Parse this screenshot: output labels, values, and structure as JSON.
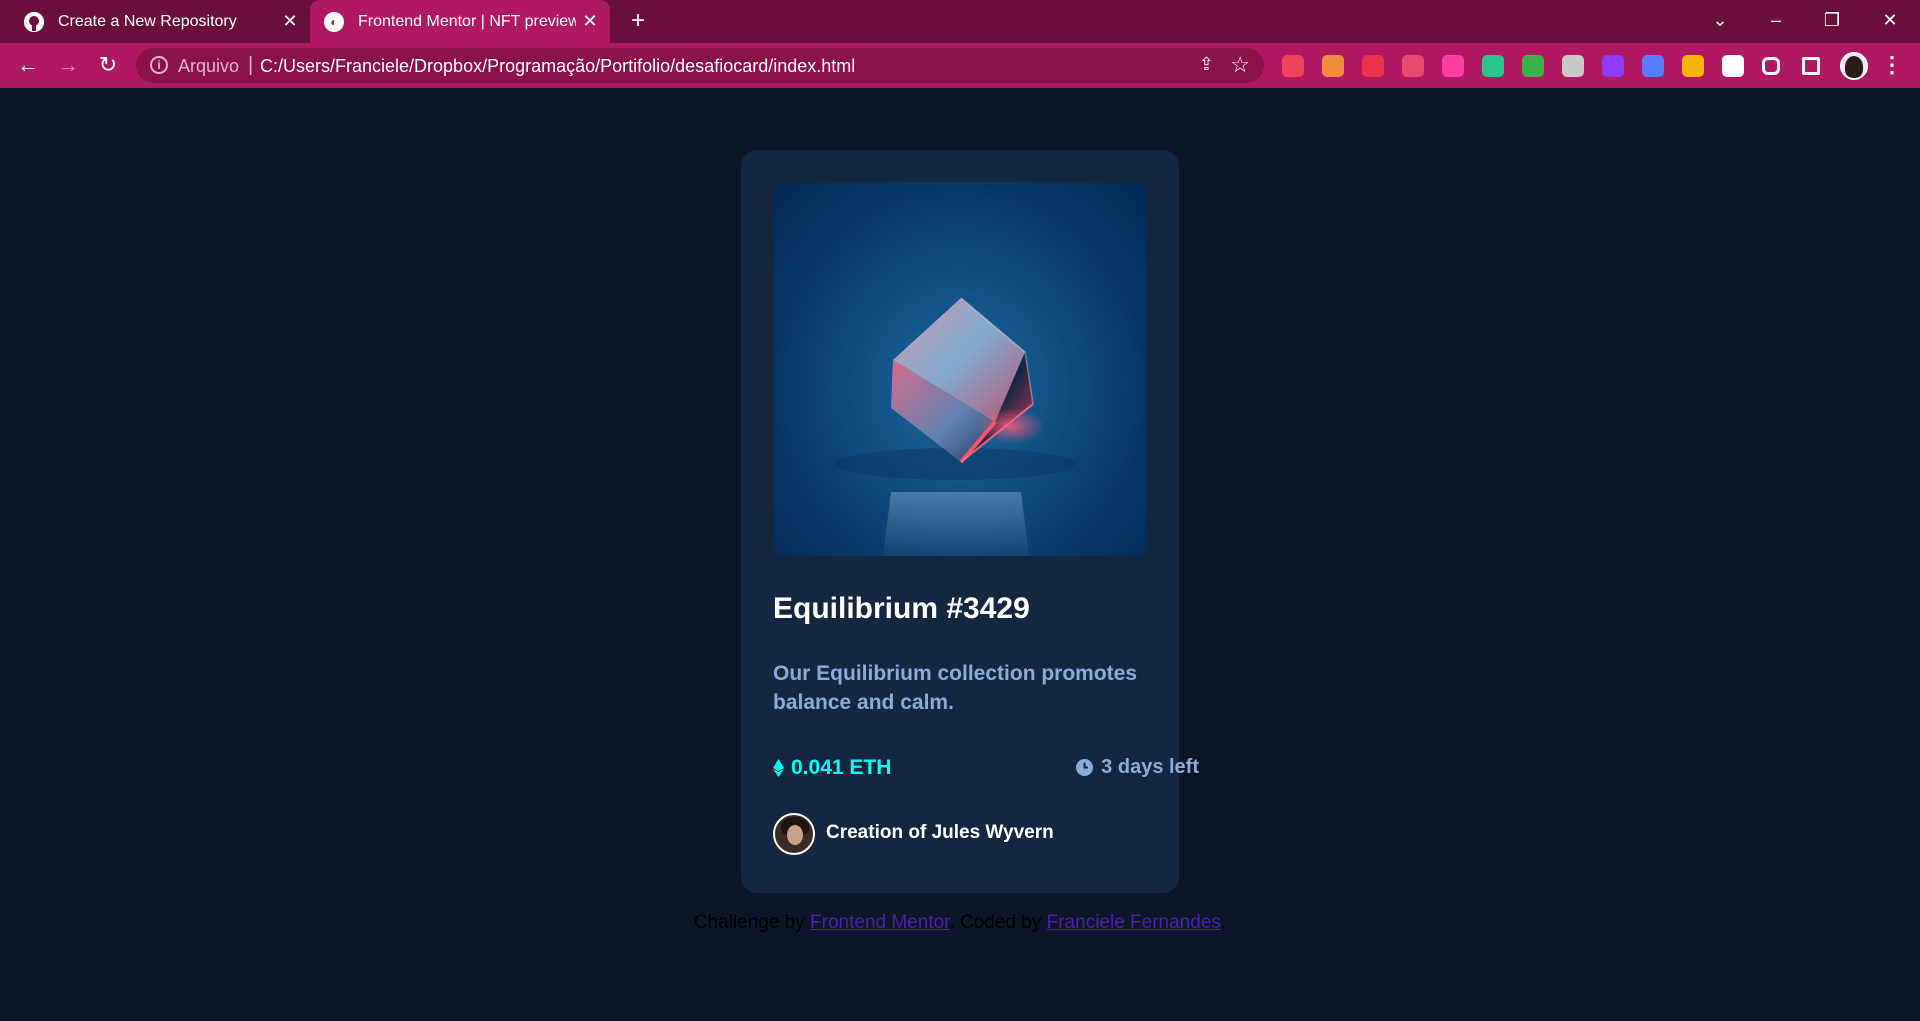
{
  "browser": {
    "tabs": [
      {
        "title": "Create a New Repository",
        "icon": "github-icon",
        "active": false
      },
      {
        "title": "Frontend Mentor | NFT preview c",
        "icon": "frontend-mentor-icon",
        "active": true
      }
    ],
    "address_bar": {
      "scheme_label": "Arquivo",
      "separator": "|",
      "url": "C:/Users/Franciele/Dropbox/Programação/Portifolio/desafiocard/index.html"
    },
    "extensions": [
      {
        "icon": "extension-gift-icon",
        "color": "#f0445a"
      },
      {
        "icon": "extension-fox-icon",
        "color": "#f08a3c"
      },
      {
        "icon": "extension-m-icon",
        "color": "#e8334a"
      },
      {
        "icon": "extension-chat-icon",
        "color": "#e84a6e"
      },
      {
        "icon": "extension-eyedropper-icon",
        "color": "#ff3fa0"
      },
      {
        "icon": "extension-bird-icon",
        "color": "#2bc48a"
      },
      {
        "icon": "extension-stack-icon",
        "color": "#3bb24a"
      },
      {
        "icon": "extension-gear-icon",
        "color": "#c9c9c9"
      },
      {
        "icon": "extension-video-icon",
        "color": "#8a3dff"
      },
      {
        "icon": "extension-flower-icon",
        "color": "#5a7cff"
      },
      {
        "icon": "extension-w-icon",
        "color": "#f4b400"
      },
      {
        "icon": "extension-table-icon",
        "color": "#ffffff"
      },
      {
        "icon": "extensions-puzzle-icon",
        "color": "#ffffff"
      },
      {
        "icon": "side-panel-icon",
        "color": "#ffffff"
      }
    ]
  },
  "card": {
    "title": "Equilibrium #3429",
    "description": "Our Equilibrium collection promotes balance and calm.",
    "price": "0.041 ETH",
    "time_left": "3 days left",
    "creator_prefix": "Creation of",
    "creator_name": "Jules Wyvern",
    "colors": {
      "accent": "#00fff8",
      "muted": "#8bacda",
      "card_bg": "#15263f",
      "page_bg": "#0d1627"
    }
  },
  "attribution": {
    "prefix": "Challenge by ",
    "challenge_link": "Frontend Mentor",
    "middle": ". Coded by ",
    "author_link": "Franciele Fernandes",
    "suffix": "."
  }
}
